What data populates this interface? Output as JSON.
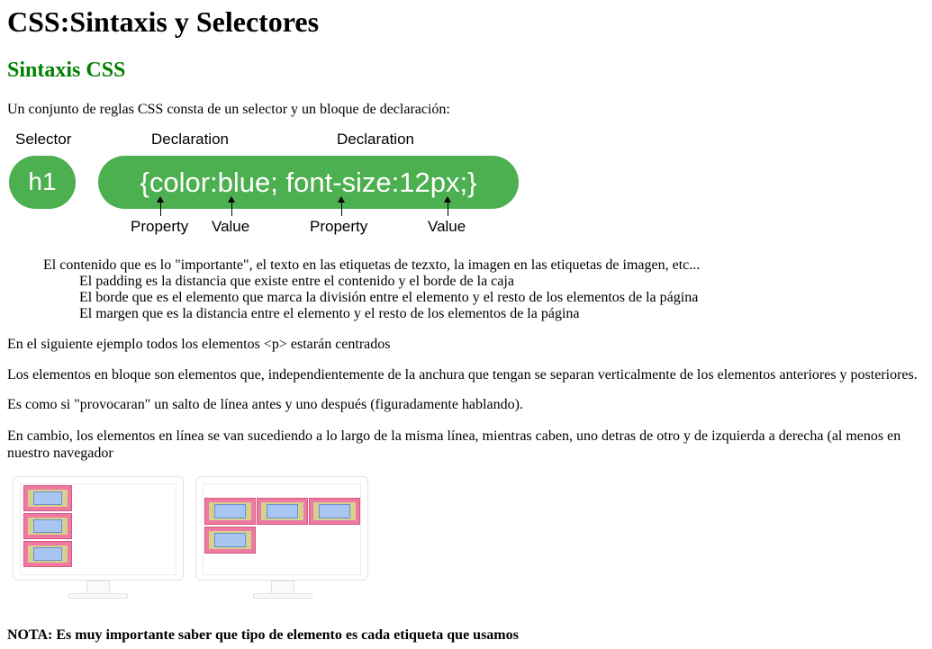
{
  "page": {
    "title": "CSS:Sintaxis y Selectores",
    "section_title": "Sintaxis CSS",
    "intro": "Un conjunto de reglas CSS consta de un selector y un bloque de declaración:"
  },
  "diagram": {
    "selector_label": "Selector",
    "declaration_label_1": "Declaration",
    "declaration_label_2": "Declaration",
    "selector_text": "h1",
    "declaration_text": "{color:blue; font-size:12px;}",
    "property_label_1": "Property",
    "value_label_1": "Value",
    "property_label_2": "Property",
    "value_label_2": "Value",
    "pill_color": "#4caf50"
  },
  "box_model": {
    "content": "El contenido que es lo \"importante\", el texto en las etiquetas de tezxto, la imagen en las etiquetas de imagen, etc...",
    "padding": "El padding es la distancia que existe entre el contenido y el borde de la caja",
    "border": "El borde que es el elemento que marca la división entre el elemento y el resto de los elementos de la página",
    "margin": "El margen que es la distancia entre el elemento y el resto de los elementos de la página"
  },
  "paragraphs": {
    "p1": "En el siguiente ejemplo todos los elementos <p> estarán centrados",
    "p2": "Los elementos en bloque son elementos que, independientemente de la anchura que tengan se separan verticalmente de los elementos anteriores y posteriores.",
    "p3": "Es como si \"provocaran\" un salto de línea antes y uno después (figuradamente hablando).",
    "p4": "En cambio, los elementos en línea se van sucediendo a lo largo de la misma línea, mientras caben, uno detras de otro y de izquierda a derecha (al menos en nuestro navegador"
  },
  "note": "NOTA: Es muy importante saber que tipo de elemento es cada etiqueta que usamos"
}
